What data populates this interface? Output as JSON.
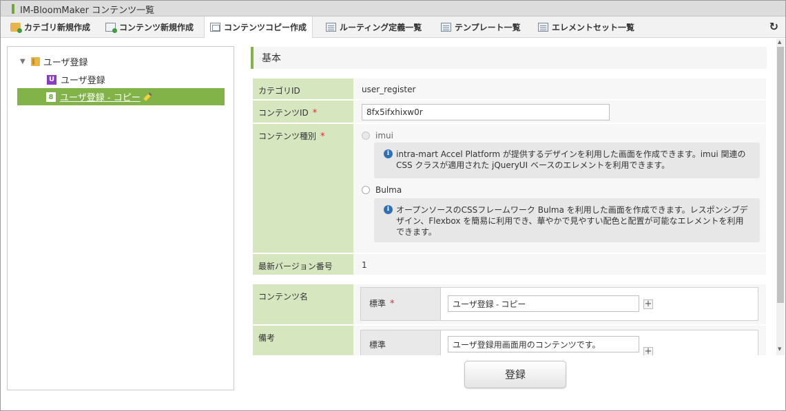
{
  "window": {
    "title": "IM-BloomMaker コンテンツ一覧"
  },
  "toolbar": {
    "items": [
      {
        "label": "カテゴリ新規作成",
        "icon": "folder-add-icon"
      },
      {
        "label": "コンテンツ新規作成",
        "icon": "content-add-icon"
      },
      {
        "label": "コンテンツコピー作成",
        "icon": "copy-icon",
        "active": true
      },
      {
        "label": "ルーティング定義一覧",
        "icon": "list-icon"
      },
      {
        "label": "テンプレート一覧",
        "icon": "list-icon"
      },
      {
        "label": "エレメントセット一覧",
        "icon": "list-icon"
      }
    ],
    "refresh_icon": "refresh-icon"
  },
  "tree": {
    "root_label": "ユーザ登録",
    "children": [
      {
        "badge": "U",
        "label": "ユーザ登録",
        "badge_color": "#8a3cc4"
      },
      {
        "badge": "8",
        "label": "ユーザ登録 - コピー",
        "selected": true
      }
    ]
  },
  "form": {
    "section_title": "基本",
    "category_id": {
      "label": "カテゴリID",
      "value": "user_register"
    },
    "content_id": {
      "label": "コンテンツID",
      "required_mark": "*",
      "value": "8fx5ifxhixw0r"
    },
    "content_type": {
      "label": "コンテンツ種別",
      "required_mark": "*",
      "options": [
        {
          "label": "imui",
          "disabled": true,
          "info": "intra-mart Accel Platform が提供するデザインを利用した画面を作成できます。imui 関連の CSS クラスが適用された jQueryUI ベースのエレメントを利用できます。"
        },
        {
          "label": "Bulma",
          "disabled": false,
          "info": "オープンソースのCSSフレームワーク Bulma を利用した画面を作成できます。レスポンシブデザイン、Flexbox を簡易に利用でき、華やかで見やすい配色と配置が可能なエレメントを利用できます。"
        }
      ]
    },
    "latest_version": {
      "label": "最新バージョン番号",
      "value": "1"
    },
    "content_name": {
      "label": "コンテンツ名",
      "locale_label": "標準",
      "required_mark": "*",
      "value": "ユーザ登録 - コピー"
    },
    "remarks": {
      "label": "備考",
      "locale_label": "標準",
      "value": "ユーザ登録用画面用のコンテンツです。"
    },
    "submit_label": "登録"
  },
  "colors": {
    "accent": "#82b349",
    "label_bg": "#d6e7c0",
    "required": "#e0262f"
  }
}
